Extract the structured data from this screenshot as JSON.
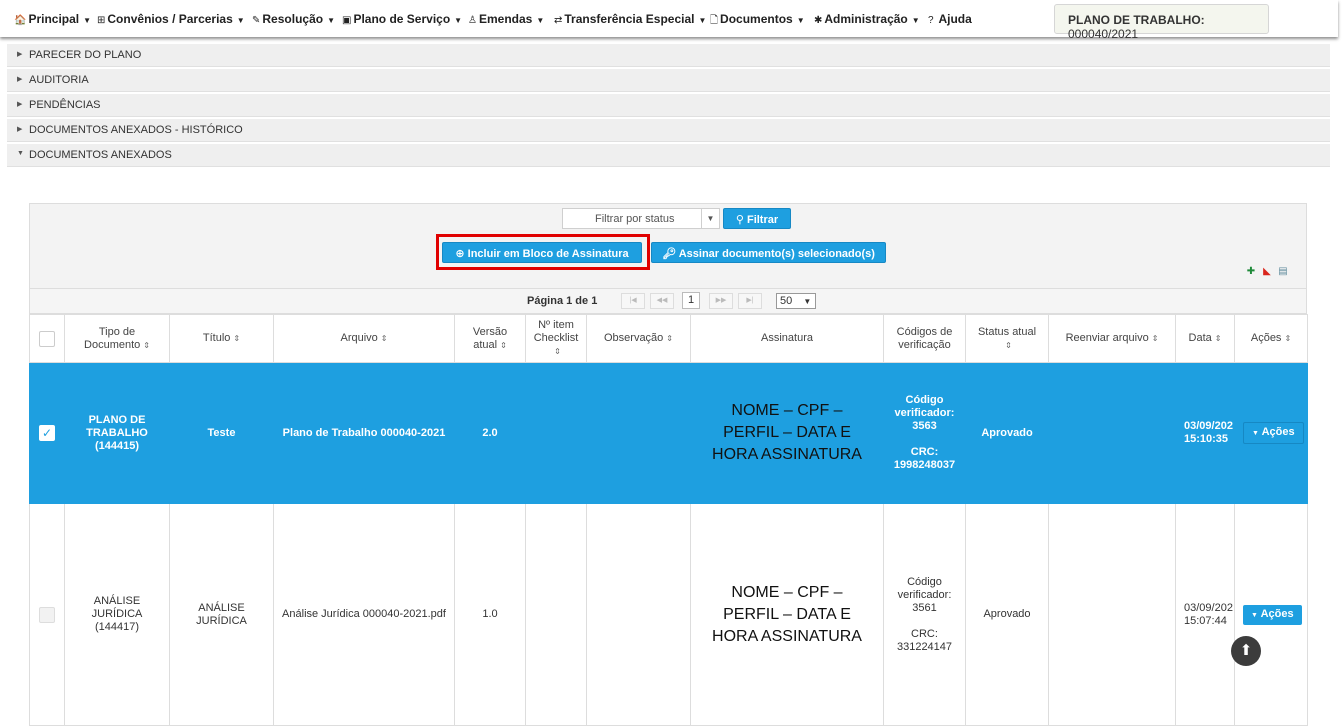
{
  "nav": {
    "items": [
      {
        "icon": "🏠",
        "label": "Principal"
      },
      {
        "icon": "⊞",
        "label": "Convênios / Parcerias"
      },
      {
        "icon": "✎",
        "label": "Resolução"
      },
      {
        "icon": "▣",
        "label": "Plano de Serviço"
      },
      {
        "icon": "♙",
        "label": "Emendas"
      },
      {
        "icon": "⇄",
        "label": "Transferência Especial"
      },
      {
        "icon": "🗋",
        "label": "Documentos"
      },
      {
        "icon": "✱",
        "label": "Administração"
      },
      {
        "icon": "?",
        "label": "Ajuda"
      }
    ],
    "plan_label": "PLANO DE TRABALHO:",
    "plan_number": "000040/2021"
  },
  "accordion": [
    "PARECER DO PLANO",
    "AUDITORIA",
    "PENDÊNCIAS",
    "DOCUMENTOS ANEXADOS - HISTÓRICO",
    "DOCUMENTOS ANEXADOS"
  ],
  "filter": {
    "status_placeholder": "Filtrar por status",
    "filter_button": "Filtrar"
  },
  "actions": {
    "include_block": "Incluir em Bloco de Assinatura",
    "sign_selected": "Assinar documento(s) selecionado(s)"
  },
  "pager": {
    "label": "Página 1 de 1",
    "current": "1",
    "page_size": "50"
  },
  "columns": {
    "tipo1": "Tipo de",
    "tipo2": "Documento",
    "titulo": "Título",
    "arquivo": "Arquivo",
    "versao1": "Versão",
    "versao2": "atual",
    "checklist1": "Nº item",
    "checklist2": "Checklist",
    "observacao": "Observação",
    "assinatura": "Assinatura",
    "codigos1": "Códigos de",
    "codigos2": "verificação",
    "status1": "Status atual",
    "reenviar": "Reenviar arquivo",
    "data": "Data",
    "acoes": "Ações"
  },
  "rows": [
    {
      "tipo1": "PLANO DE",
      "tipo2": "TRABALHO",
      "tipo3": "(144415)",
      "titulo": "Teste",
      "arquivo": "Plano de Trabalho 000040-2021",
      "versao": "2.0",
      "sig1": "NOME – CPF –",
      "sig2": "PERFIL – DATA E",
      "sig3": "HORA ASSINATURA",
      "cod1": "Código",
      "cod2": "verificador:",
      "cod3": "3563",
      "crc_label": "CRC:",
      "crc": "1998248037",
      "status": "Aprovado",
      "data1": "03/09/202",
      "data2": "15:10:35",
      "acoes": "Ações"
    },
    {
      "tipo1": "ANÁLISE",
      "tipo2": "JURÍDICA",
      "tipo3": "(144417)",
      "titulo1": "ANÁLISE",
      "titulo2": "JURÍDICA",
      "arquivo": "Análise Jurídica 000040-2021.pdf",
      "versao": "1.0",
      "sig1": "NOME – CPF –",
      "sig2": "PERFIL – DATA E",
      "sig3": "HORA ASSINATURA",
      "cod1": "Código",
      "cod2": "verificador:",
      "cod3": "3561",
      "crc_label": "CRC:",
      "crc": "331224147",
      "status": "Aprovado",
      "data1": "03/09/202",
      "data2": "15:07:44",
      "acoes": "Ações"
    }
  ],
  "colors": {
    "primary": "#1e9fe0",
    "highlight": "#e00000"
  }
}
